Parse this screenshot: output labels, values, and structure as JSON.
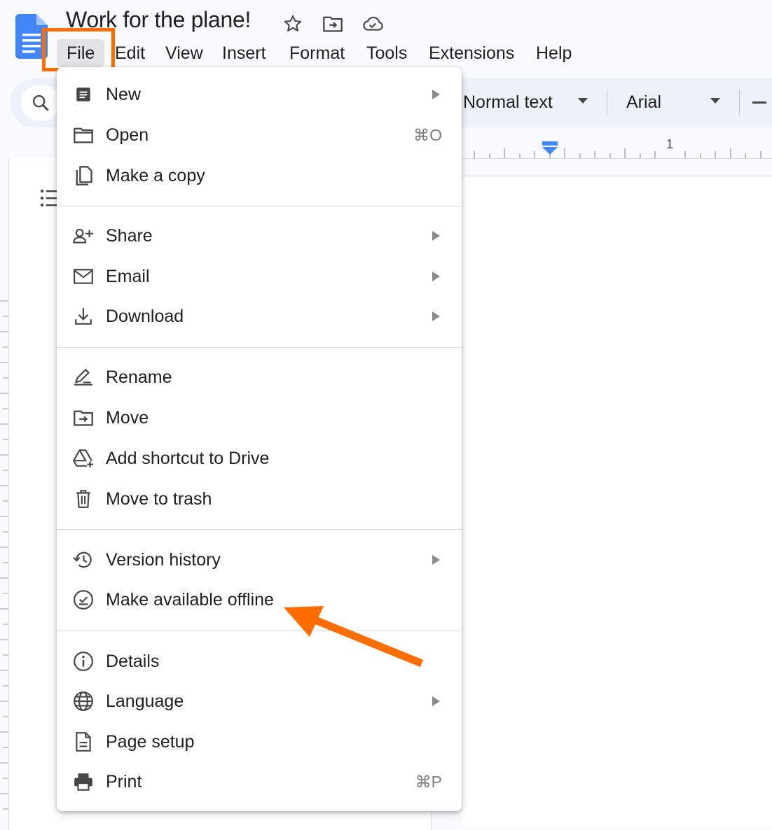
{
  "document": {
    "title": "Work for the plane!"
  },
  "header_icons": [
    "star-icon",
    "move-to-folder-icon",
    "cloud-saved-icon"
  ],
  "menubar": {
    "items": [
      {
        "label": "File",
        "active": true
      },
      {
        "label": "Edit"
      },
      {
        "label": "View"
      },
      {
        "label": "Insert"
      },
      {
        "label": "Format"
      },
      {
        "label": "Tools"
      },
      {
        "label": "Extensions"
      },
      {
        "label": "Help"
      }
    ]
  },
  "toolbar": {
    "paragraph_style": "Normal text",
    "font": "Arial"
  },
  "ruler": {
    "number": "1"
  },
  "file_menu": {
    "groups": [
      [
        {
          "label": "New",
          "icon": "document-icon",
          "submenu": true
        },
        {
          "label": "Open",
          "icon": "folder-icon",
          "shortcut": "⌘O"
        },
        {
          "label": "Make a copy",
          "icon": "copy-icon"
        }
      ],
      [
        {
          "label": "Share",
          "icon": "person-add-icon",
          "submenu": true
        },
        {
          "label": "Email",
          "icon": "mail-icon",
          "submenu": true
        },
        {
          "label": "Download",
          "icon": "download-icon",
          "submenu": true
        }
      ],
      [
        {
          "label": "Rename",
          "icon": "rename-icon"
        },
        {
          "label": "Move",
          "icon": "move-folder-icon"
        },
        {
          "label": "Add shortcut to Drive",
          "icon": "drive-shortcut-icon"
        },
        {
          "label": "Move to trash",
          "icon": "trash-icon"
        }
      ],
      [
        {
          "label": "Version history",
          "icon": "history-icon",
          "submenu": true
        },
        {
          "label": "Make available offline",
          "icon": "offline-check-icon"
        }
      ],
      [
        {
          "label": "Details",
          "icon": "info-icon"
        },
        {
          "label": "Language",
          "icon": "globe-icon",
          "submenu": true
        },
        {
          "label": "Page setup",
          "icon": "page-setup-icon"
        },
        {
          "label": "Print",
          "icon": "print-icon",
          "shortcut": "⌘P"
        }
      ]
    ]
  },
  "annotation": {
    "color": "#ff6d00",
    "highlight": "File",
    "points_to": "Make available offline"
  }
}
